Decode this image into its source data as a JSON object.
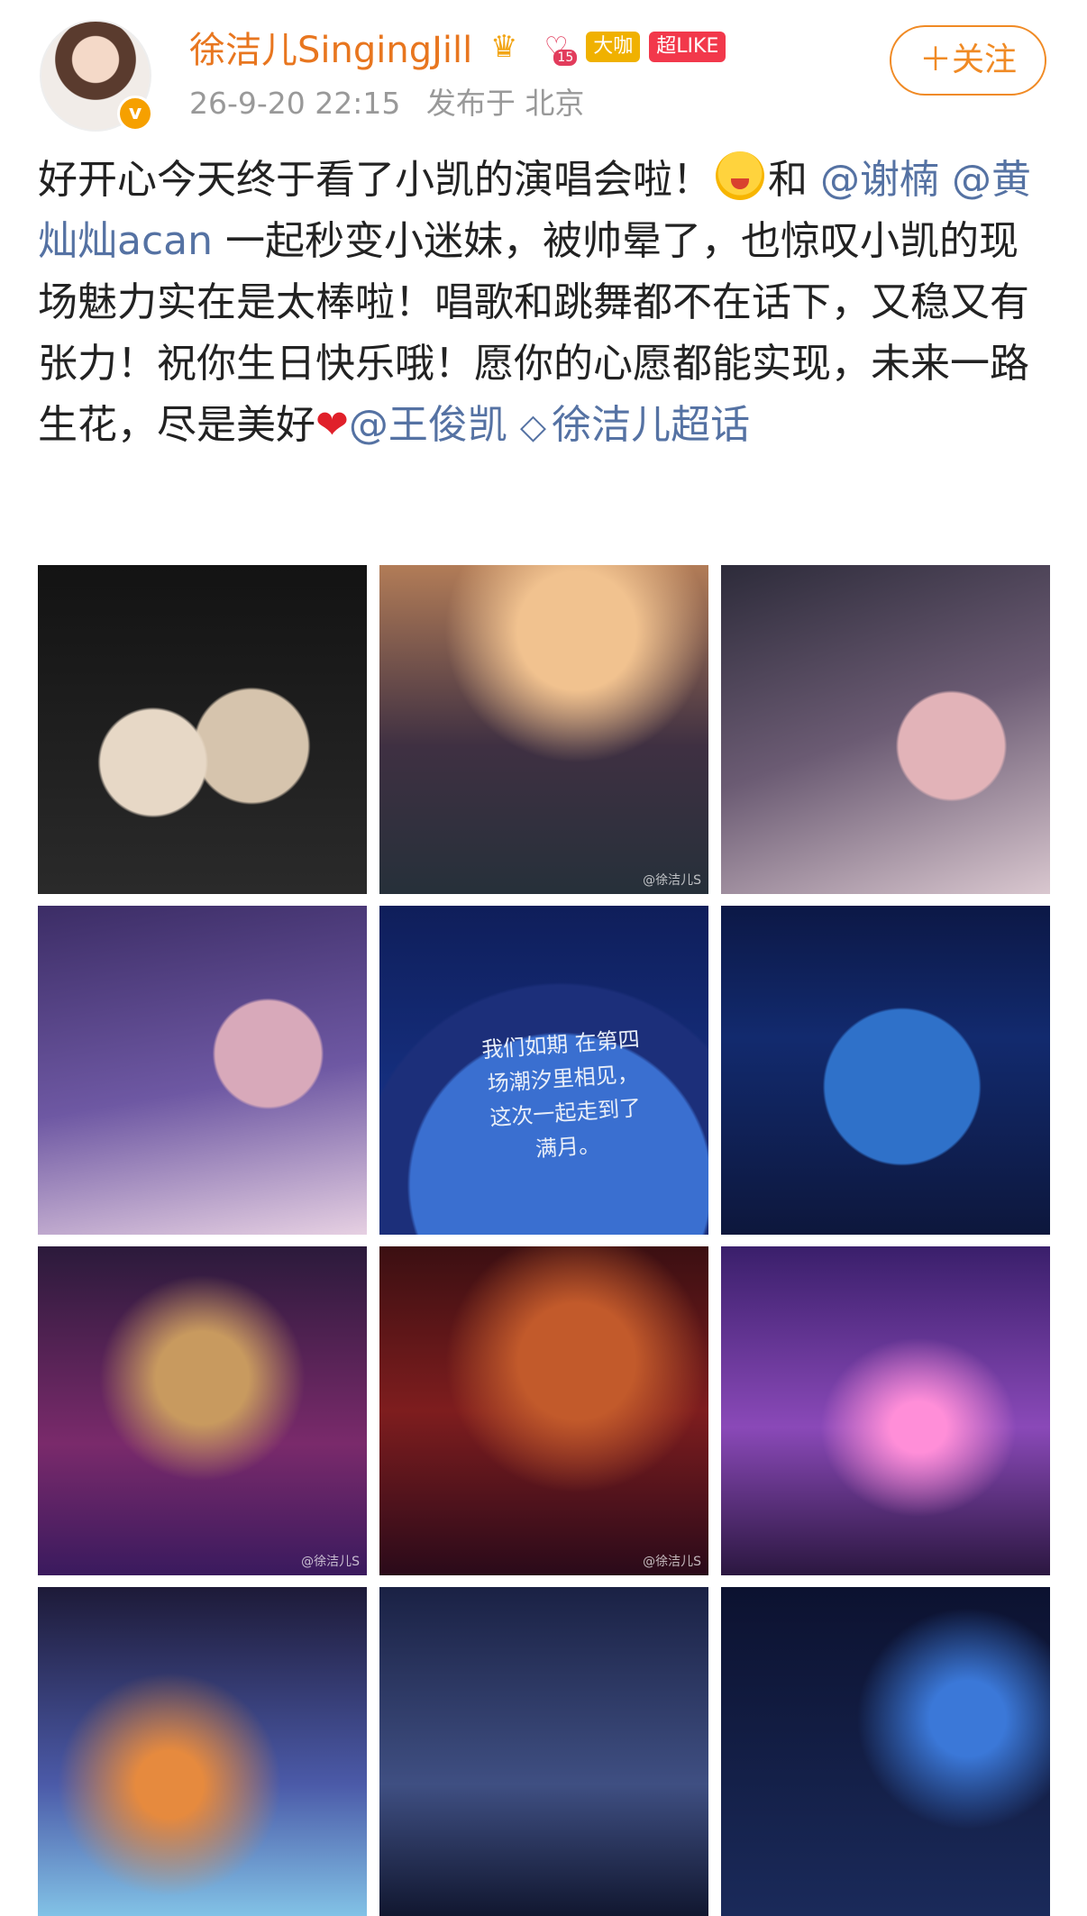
{
  "header": {
    "username": "徐洁儿SingingJill",
    "level_num": "15",
    "tag_gold": "大咖",
    "tag_red": "超LIKE",
    "timestamp": "26-9-20 22:15",
    "location": "发布于 北京",
    "follow_label": "＋关注",
    "verified_mark": "v"
  },
  "body": {
    "seg1": "好开心今天终于看了小凯的演唱会啦！",
    "seg2": "和",
    "mention1": "@谢楠",
    "mention2": "@黄灿灿acan",
    "seg3": "一起秒变小迷妹，被帅晕了，也惊叹小凯的现场魅力实在是太棒啦！唱歌和跳舞都不在话下，又稳又有张力！祝你生日快乐哦！愿你的心愿都能实现，未来一路生花，尽是美好",
    "heart": "❤",
    "mention3": "@王俊凯",
    "topic": "徐洁儿超话"
  },
  "photos": {
    "caption": "我们如期 在第四场潮汐里相见， 这次一起走到了满月。",
    "watermark": "@徐洁儿S"
  },
  "colors": {
    "accent": "#f08a24",
    "link": "#5572a3"
  }
}
